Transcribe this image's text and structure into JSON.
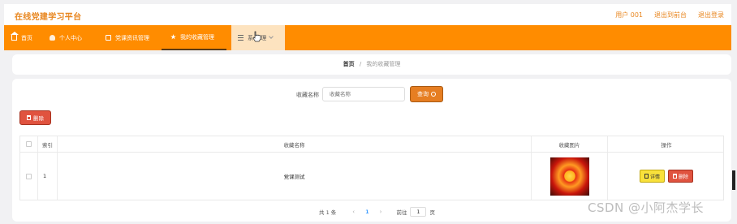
{
  "header": {
    "app_title": "在线党建学习平台",
    "links": [
      "用户 001",
      "退出到前台",
      "退出登录"
    ]
  },
  "nav": {
    "items": [
      {
        "label": "首页",
        "icon": "home-icon"
      },
      {
        "label": "个人中心",
        "icon": "user-icon"
      },
      {
        "label": "党课资讯管理",
        "icon": "book-icon"
      },
      {
        "label": "我的收藏管理",
        "icon": "star-icon",
        "active": true
      },
      {
        "label": "系统管理",
        "icon": "menu-icon",
        "hover": true
      }
    ],
    "visible_label_last": "系 管理"
  },
  "breadcrumb": {
    "home": "首页",
    "separator": "/",
    "current": "我的收藏管理"
  },
  "search": {
    "label": "收藏名称",
    "placeholder": "收藏名称",
    "button_label": "查询"
  },
  "toolbar": {
    "delete_label": "删除"
  },
  "table": {
    "columns": [
      "",
      "索引",
      "收藏名称",
      "收藏图片",
      "操作"
    ],
    "rows": [
      {
        "index": "1",
        "name": "党课测试",
        "image": "party-emblem-image",
        "actions": [
          "详情",
          "删除"
        ]
      }
    ]
  },
  "pagination": {
    "total": "共 1 条",
    "prev": "‹",
    "current_page": "1",
    "next": "›",
    "goto_prefix": "前往",
    "goto_value": "1",
    "goto_suffix": "页"
  },
  "watermark": "CSDN @小阿杰学长",
  "colors": {
    "accent": "#ff8c00",
    "title": "#e8861f",
    "search_button": "#e67e22",
    "danger": "#e0533f",
    "detail": "#f9e13b"
  }
}
